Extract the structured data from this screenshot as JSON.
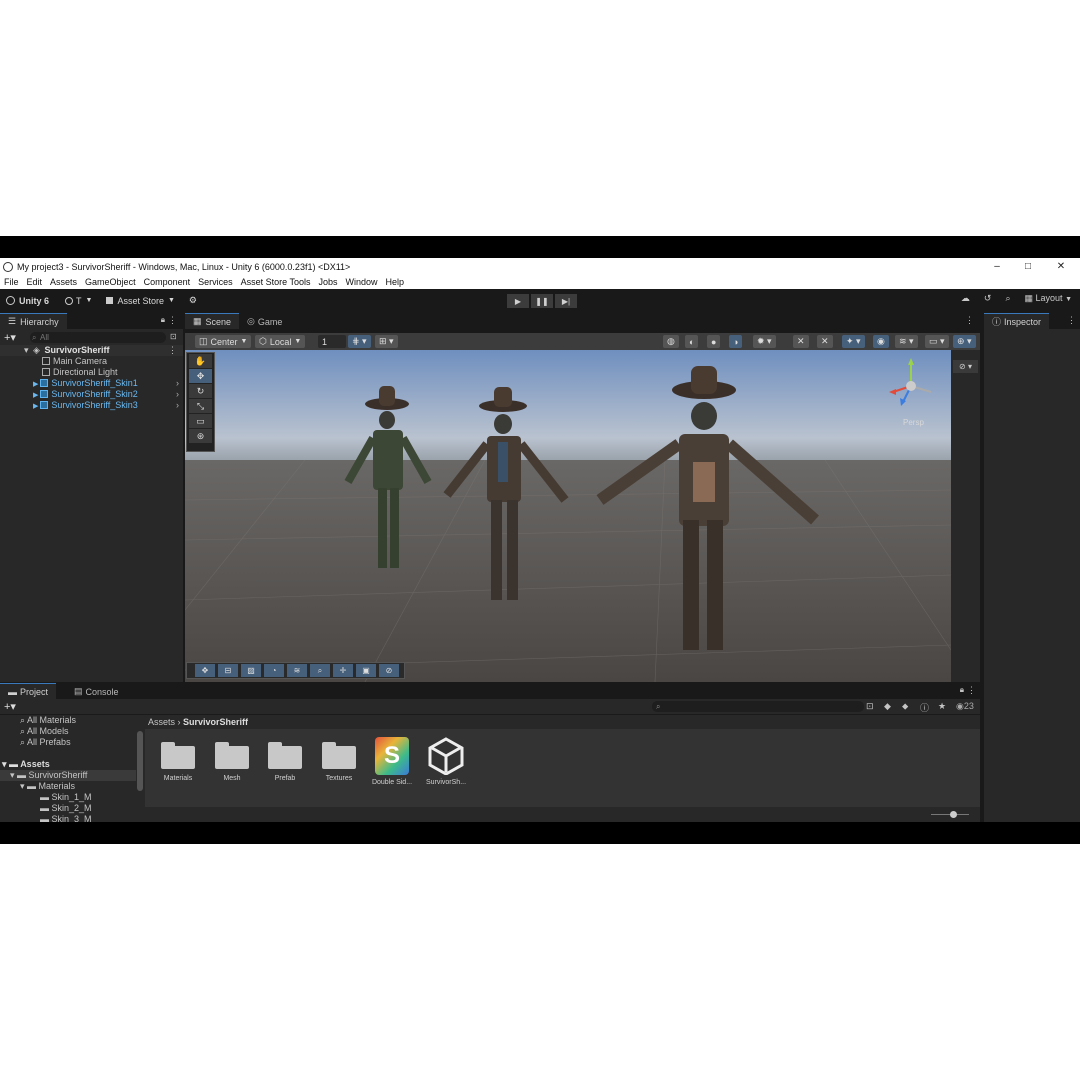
{
  "window": {
    "title": "My project3 - SurvivorSheriff - Windows, Mac, Linux - Unity 6 (6000.0.23f1) <DX11>",
    "controls": [
      "–",
      "□",
      "✕"
    ]
  },
  "menu": [
    "File",
    "Edit",
    "Assets",
    "GameObject",
    "Component",
    "Services",
    "Asset Store Tools",
    "Jobs",
    "Window",
    "Help"
  ],
  "toolbar": {
    "unity_label": "Unity 6",
    "account_label": "T",
    "asset_store_label": "Asset Store",
    "layout_label": "Layout",
    "play_icons": [
      "▶",
      "❚❚",
      "▶|"
    ]
  },
  "hierarchy": {
    "tab": "Hierarchy",
    "search_placeholder": "All",
    "scene": "SurvivorSheriff",
    "items": [
      "Main Camera",
      "Directional Light",
      "SurvivorSheriff_Skin1",
      "SurvivorSheriff_Skin2",
      "SurvivorSheriff_Skin3"
    ]
  },
  "scene_view": {
    "tabs": [
      "Scene",
      "Game"
    ],
    "pivot": "Center",
    "space": "Local",
    "grid_value": "1",
    "persp_label": "Persp"
  },
  "inspector": {
    "tab": "Inspector"
  },
  "project": {
    "tabs": [
      "Project",
      "Console"
    ],
    "count": "23",
    "favorites": [
      "All Materials",
      "All Models",
      "All Prefabs"
    ],
    "tree": [
      "Assets",
      "SurvivorSheriff",
      "Materials",
      "Skin_1_M",
      "Skin_2_M",
      "Skin_3_M"
    ],
    "breadcrumb": [
      "Assets",
      "SurvivorSheriff"
    ],
    "assets": [
      "Materials",
      "Mesh",
      "Prefab",
      "Textures",
      "Double Sid...",
      "SurvivorSh..."
    ]
  },
  "colors": {
    "accent": "#3a79bb",
    "selected": "#46607c",
    "prefab_blue": "#6ab8f0"
  }
}
